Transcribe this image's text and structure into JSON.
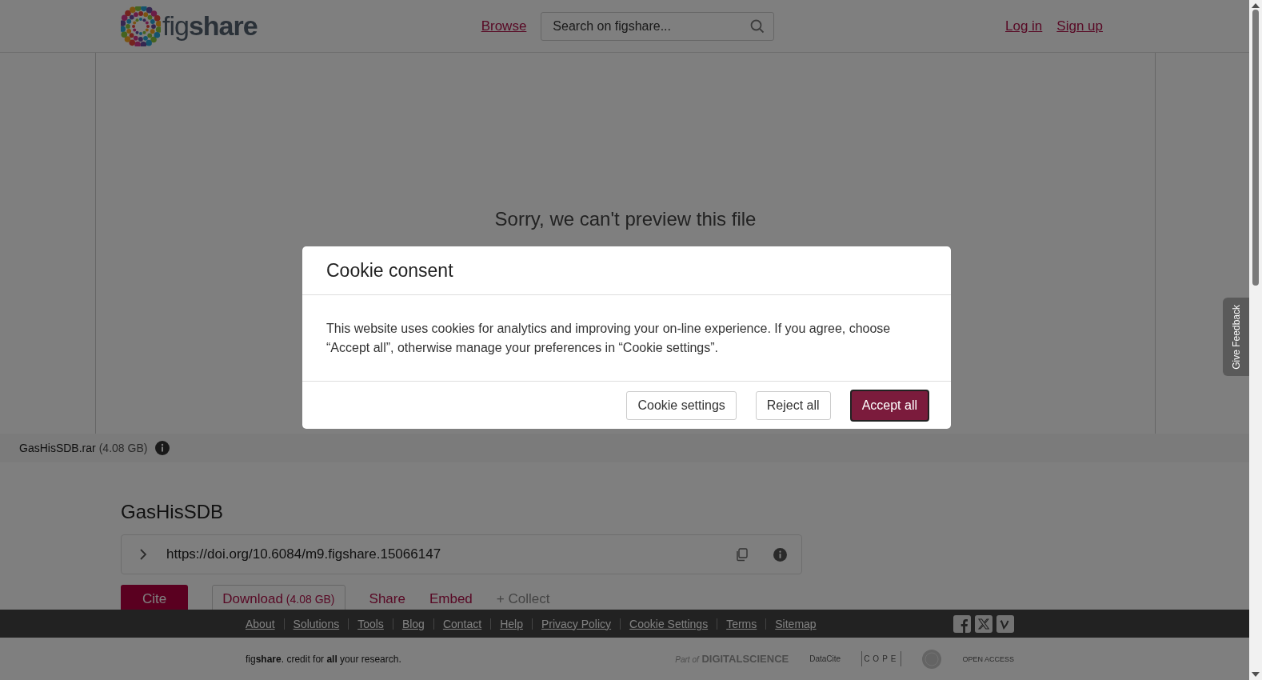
{
  "header": {
    "logo_text": "fig**share**",
    "nav_link": "Browse",
    "search": {
      "placeholder": "Search on figshare..."
    },
    "auth_links": [
      "Log in",
      "Sign up"
    ]
  },
  "preview": {
    "message": "Sorry, we can't preview this file"
  },
  "file_bar": {
    "name": "GasHisSDB.rar",
    "size": "(4.08 GB)"
  },
  "item": {
    "title": "GasHisSDB",
    "doi": "https://doi.org/10.6084/m9.figshare.15066147",
    "actions": [
      {
        "kind": "primary",
        "label": "Cite"
      },
      {
        "kind": "outline",
        "label": "Download",
        "size": "(4.08 GB)"
      },
      {
        "kind": "link",
        "label": "Share"
      },
      {
        "kind": "link",
        "label": "Embed"
      },
      {
        "kind": "muted",
        "label": "+ Collect"
      }
    ]
  },
  "footer": {
    "links": [
      "About",
      "Solutions",
      "Tools",
      "Blog",
      "Contact",
      "Help",
      "Privacy Policy",
      "Cookie Settings",
      "Terms",
      "Sitemap"
    ],
    "tagline": "fig**share**. credit for **all** your research.",
    "partner_logos": [
      {
        "kind": "digital-science",
        "prefix": "Part of",
        "name": "DIGITALSCIENCE"
      },
      {
        "kind": "datacite",
        "name": "DataCite"
      },
      {
        "kind": "cope",
        "name": "COPE"
      },
      {
        "kind": "seal"
      },
      {
        "kind": "open-access",
        "name": "OPEN ACCESS"
      }
    ]
  },
  "feedback_tab": {
    "label": "Give Feedback"
  },
  "modal": {
    "title": "Cookie consent",
    "body": "This website uses cookies for analytics and improving your on-line experience. If you agree, choose “Accept all”, otherwise manage your preferences in “Cookie settings”.",
    "buttons": [
      {
        "kind": "secondary",
        "label": "Cookie settings"
      },
      {
        "kind": "secondary",
        "label": "Reject all"
      },
      {
        "kind": "primary",
        "label": "Accept all"
      }
    ]
  }
}
